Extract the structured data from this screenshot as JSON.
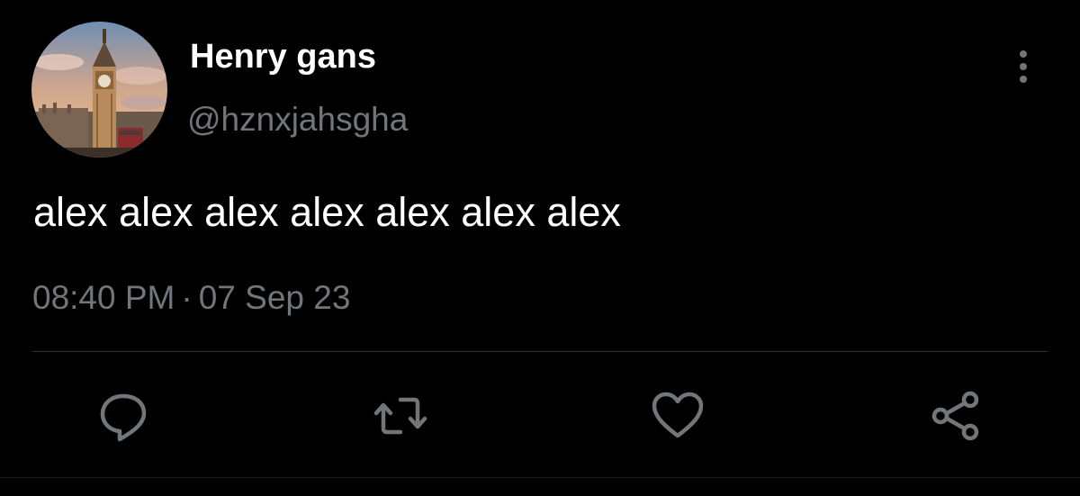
{
  "tweet": {
    "author": {
      "display_name": "Henry gans",
      "handle": "@hznxjahsgha",
      "avatar_icon": "avatar-image"
    },
    "text": "alex alex alex alex alex alex alex",
    "time": "08:40 PM",
    "separator": "·",
    "date": "07 Sep 23",
    "more_icon": "more-vertical-icon"
  },
  "actions": [
    {
      "name": "reply",
      "icon": "reply-icon"
    },
    {
      "name": "retweet",
      "icon": "retweet-icon"
    },
    {
      "name": "like",
      "icon": "heart-icon"
    },
    {
      "name": "share",
      "icon": "share-icon"
    }
  ],
  "colors": {
    "background": "#000000",
    "primary_text": "#ffffff",
    "secondary_text": "#71767b",
    "divider": "#2f3336"
  }
}
